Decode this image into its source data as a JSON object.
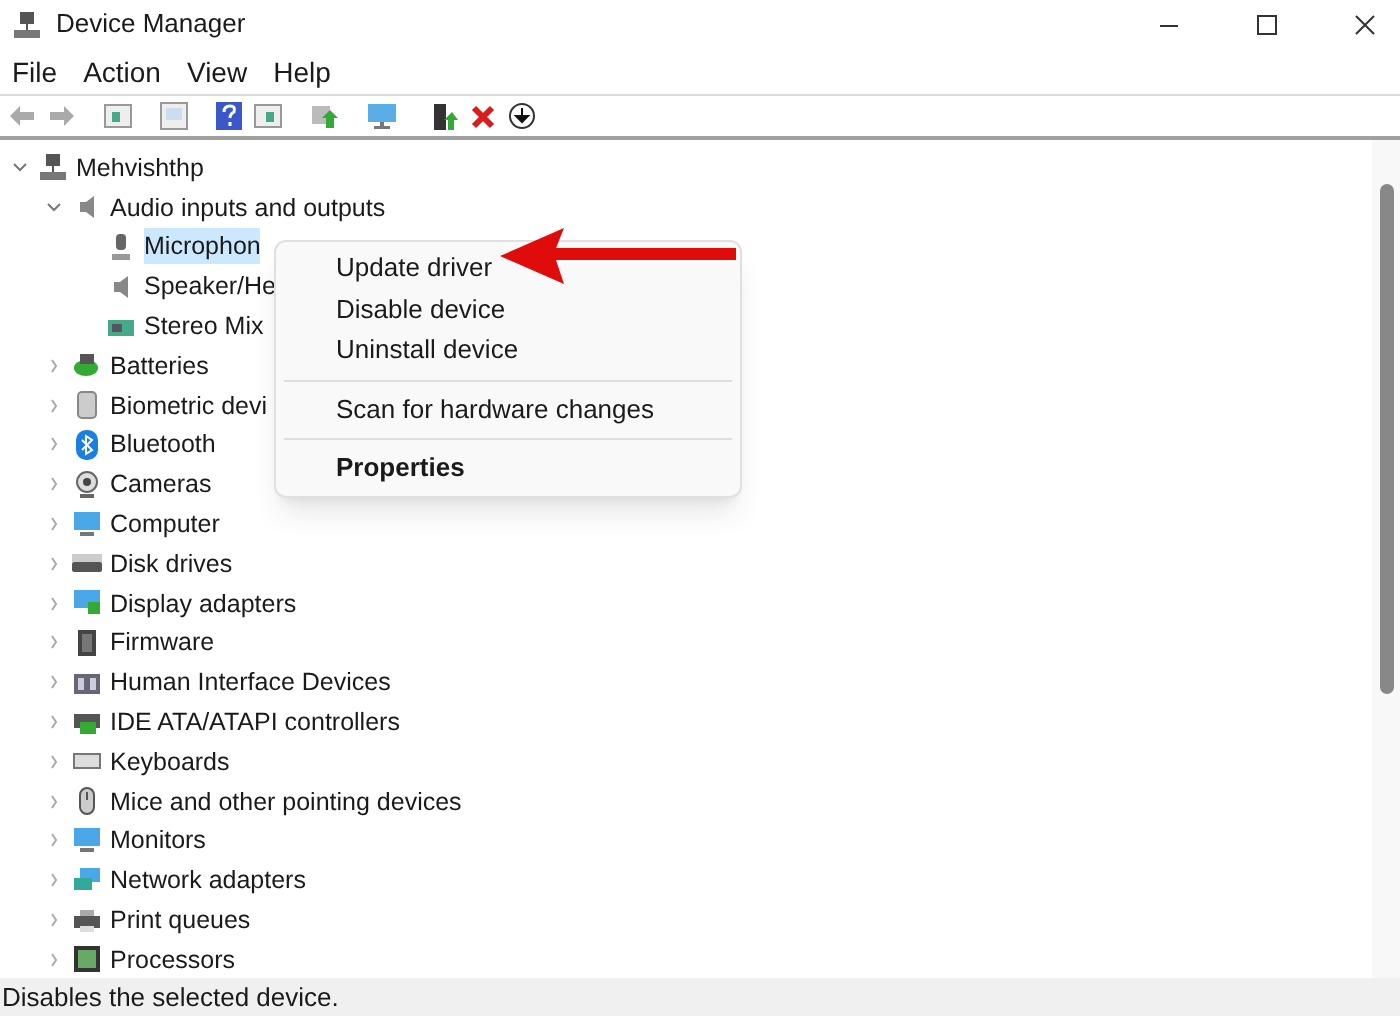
{
  "window": {
    "title": "Device Manager"
  },
  "menu": [
    "File",
    "Action",
    "View",
    "Help"
  ],
  "tree": {
    "label": "Mehvishthp",
    "expanded": true,
    "selected": false,
    "children": [
      {
        "label": "Audio inputs and outputs",
        "expanded": true,
        "selected": false,
        "children": [
          {
            "label": "Microphon",
            "selected": true
          },
          {
            "label": "Speaker/He",
            "selected": false
          },
          {
            "label": "Stereo Mix",
            "selected": false
          }
        ]
      },
      {
        "label": "Batteries",
        "expanded": false,
        "selected": false
      },
      {
        "label": "Biometric devi",
        "expanded": false,
        "selected": false
      },
      {
        "label": "Bluetooth",
        "expanded": false,
        "selected": false
      },
      {
        "label": "Cameras",
        "expanded": false,
        "selected": false
      },
      {
        "label": "Computer",
        "expanded": false,
        "selected": false
      },
      {
        "label": "Disk drives",
        "expanded": false,
        "selected": false
      },
      {
        "label": "Display adapters",
        "expanded": false,
        "selected": false
      },
      {
        "label": "Firmware",
        "expanded": false,
        "selected": false
      },
      {
        "label": "Human Interface Devices",
        "expanded": false,
        "selected": false
      },
      {
        "label": "IDE ATA/ATAPI controllers",
        "expanded": false,
        "selected": false
      },
      {
        "label": "Keyboards",
        "expanded": false,
        "selected": false
      },
      {
        "label": "Mice and other pointing devices",
        "expanded": false,
        "selected": false
      },
      {
        "label": "Monitors",
        "expanded": false,
        "selected": false
      },
      {
        "label": "Network adapters",
        "expanded": false,
        "selected": false
      },
      {
        "label": "Print queues",
        "expanded": false,
        "selected": false
      },
      {
        "label": "Processors",
        "expanded": false,
        "selected": false
      }
    ]
  },
  "context_menu": {
    "items": [
      {
        "kind": "item",
        "label": "Update driver",
        "default": false
      },
      {
        "kind": "item",
        "label": "Disable device",
        "default": false
      },
      {
        "kind": "item",
        "label": "Uninstall device",
        "default": false
      },
      {
        "kind": "separator"
      },
      {
        "kind": "item",
        "label": "Scan for hardware changes",
        "default": false
      },
      {
        "kind": "separator"
      },
      {
        "kind": "item",
        "label": "Properties",
        "default": true
      }
    ]
  },
  "status_bar": "Disables the selected device."
}
